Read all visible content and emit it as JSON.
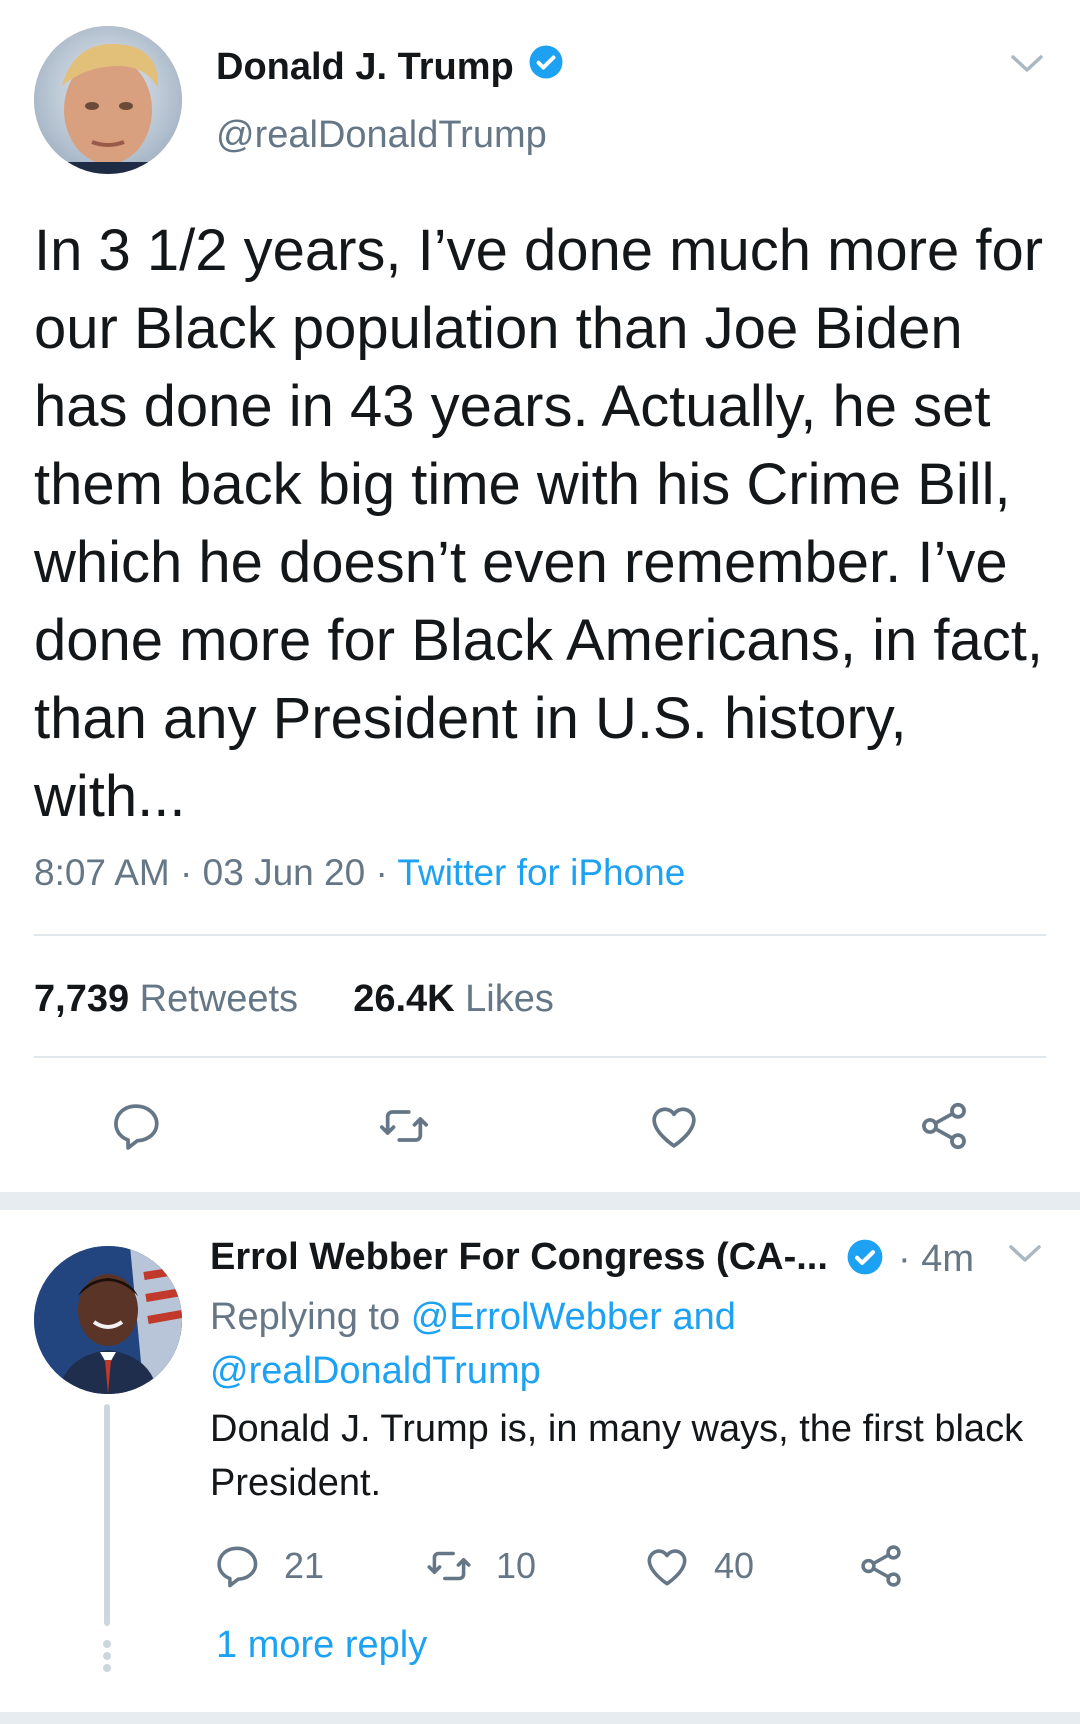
{
  "main_tweet": {
    "author": {
      "name": "Donald J. Trump",
      "handle": "@realDonaldTrump",
      "verified": true
    },
    "text": "In 3 1/2 years, I’ve done much more for our Black population than Joe Biden has done in 43 years. Actually, he set them back big time with his Crime Bill, which he doesn’t even remember. I’ve done more for Black Americans, in fact, than any President in U.S. history, with...",
    "time": "8:07 AM",
    "date": "03 Jun 20",
    "separator": "·",
    "source": "Twitter for iPhone",
    "stats": {
      "retweets_count": "7,739",
      "retweets_label": "Retweets",
      "likes_count": "26.4K",
      "likes_label": "Likes"
    },
    "actions": [
      "reply-icon",
      "retweet-icon",
      "like-icon",
      "share-icon"
    ]
  },
  "reply_tweet": {
    "author": {
      "name": "Errol Webber For Congress (CA-...",
      "verified": true
    },
    "time": "· 4m",
    "replying_prefix": "Replying to",
    "replying_to_1": "@ErrolWebber",
    "replying_and": "and",
    "replying_to_2": "@realDonaldTrump",
    "text": "Donald J. Trump is, in many ways, the first black President.",
    "stats": {
      "replies": "21",
      "retweets": "10",
      "likes": "40"
    },
    "more_replies": "1 more reply"
  },
  "colors": {
    "accent": "#1da1f2",
    "text": "#14171a",
    "secondary": "#657786",
    "divider": "#e1e8ed"
  }
}
